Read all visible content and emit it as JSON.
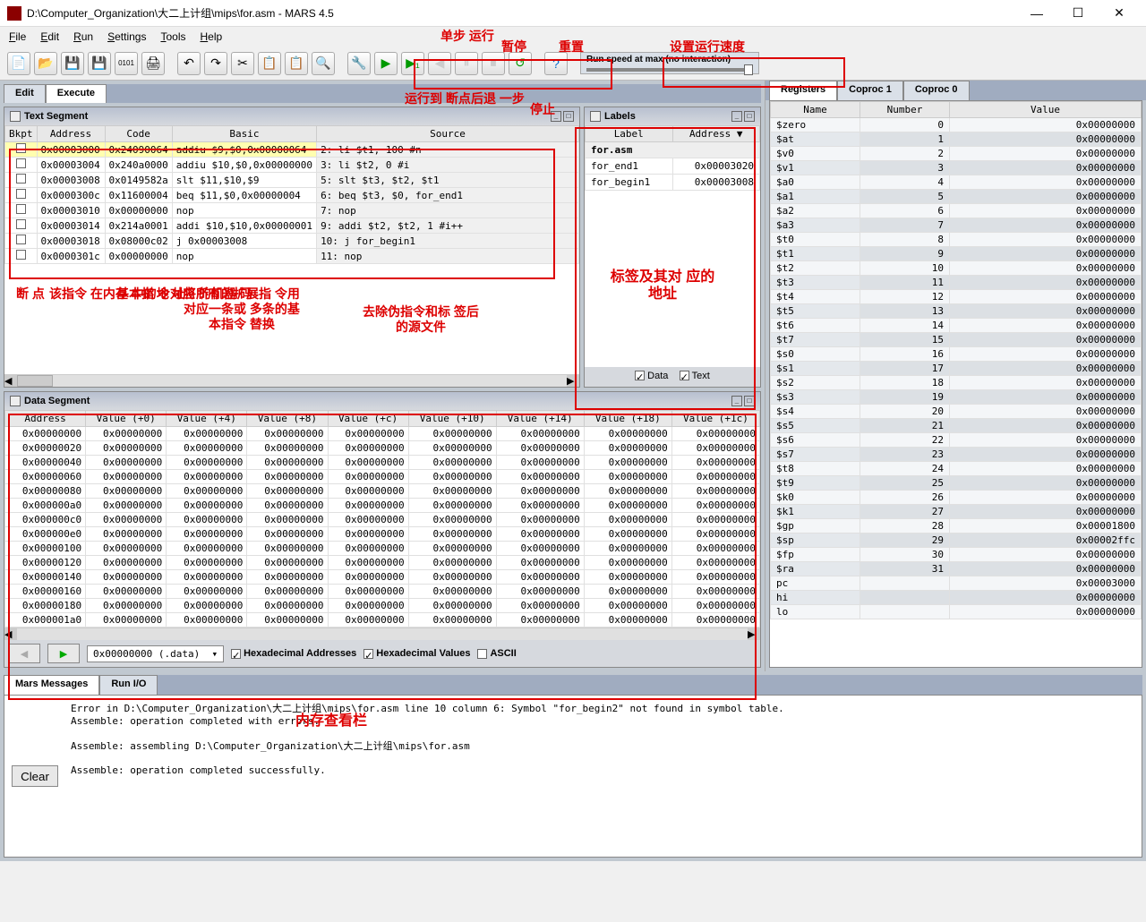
{
  "window": {
    "title": "D:\\Computer_Organization\\大二上计组\\mips\\for.asm  -  MARS 4.5"
  },
  "menu": {
    "items": [
      "File",
      "Edit",
      "Run",
      "Settings",
      "Tools",
      "Help"
    ]
  },
  "annotations": {
    "step": "单步\n运行",
    "pause": "暂停",
    "reset": "重置",
    "speed": "设置运行速度",
    "runToBp": "运行到\n断点",
    "stepBack": "后退\n一步",
    "stop": "停止",
    "bkpt": "断\n点",
    "addrNote": "该指令\n在内存\n中的地\n址",
    "codeNote": "基本指\n令对应\n的机器\n码",
    "basicNote": "将所有的扩展指\n令用对应一条或\n多条的基本指令\n替换",
    "sourceNote": "去除伪指令和标\n签后的源文件",
    "labelsNote": "标签及其对\n应的地址",
    "dataNote": "内存查看栏"
  },
  "speed": {
    "label": "Run speed at max (no interaction)"
  },
  "tabs": {
    "edit": "Edit",
    "execute": "Execute"
  },
  "regTabs": {
    "r": "Registers",
    "c1": "Coproc 1",
    "c0": "Coproc 0"
  },
  "textSeg": {
    "title": "Text Segment",
    "headers": {
      "bkpt": "Bkpt",
      "addr": "Address",
      "code": "Code",
      "basic": "Basic",
      "source": "Source"
    },
    "rows": [
      {
        "addr": "0x00003000",
        "code": "0x24090064",
        "basic": "addiu $9,$0,0x00000064",
        "src": "2: li $t1, 100 #n",
        "hl": true
      },
      {
        "addr": "0x00003004",
        "code": "0x240a0000",
        "basic": "addiu $10,$0,0x00000000",
        "src": "3: li $t2, 0   #i"
      },
      {
        "addr": "0x00003008",
        "code": "0x0149582a",
        "basic": "slt $11,$10,$9",
        "src": "5:    slt $t3, $t2, $t1"
      },
      {
        "addr": "0x0000300c",
        "code": "0x11600004",
        "basic": "beq $11,$0,0x00000004",
        "src": "6:    beq $t3, $0, for_end1"
      },
      {
        "addr": "0x00003010",
        "code": "0x00000000",
        "basic": "nop",
        "src": "7:    nop"
      },
      {
        "addr": "0x00003014",
        "code": "0x214a0001",
        "basic": "addi $10,$10,0x00000001",
        "src": "9:    addi $t2, $t2, 1 #i++"
      },
      {
        "addr": "0x00003018",
        "code": "0x08000c02",
        "basic": "j 0x00003008",
        "src": "10:   j for_begin1"
      },
      {
        "addr": "0x0000301c",
        "code": "0x00000000",
        "basic": "nop",
        "src": "11:   nop"
      }
    ]
  },
  "labels": {
    "title": "Labels",
    "headers": {
      "label": "Label",
      "addr": "Address ▼"
    },
    "file": "for.asm",
    "rows": [
      {
        "label": "for_end1",
        "addr": "0x00003020"
      },
      {
        "label": "for_begin1",
        "addr": "0x00003008"
      }
    ],
    "checks": {
      "data": "Data",
      "text": "Text"
    }
  },
  "dataSeg": {
    "title": "Data Segment",
    "headers": [
      "Address",
      "Value (+0)",
      "Value (+4)",
      "Value (+8)",
      "Value (+c)",
      "Value (+10)",
      "Value (+14)",
      "Value (+18)",
      "Value (+1c)"
    ],
    "addrs": [
      "0x00000000",
      "0x00000020",
      "0x00000040",
      "0x00000060",
      "0x00000080",
      "0x000000a0",
      "0x000000c0",
      "0x000000e0",
      "0x00000100",
      "0x00000120",
      "0x00000140",
      "0x00000160",
      "0x00000180",
      "0x000001a0"
    ],
    "zero": "0x00000000",
    "combo": "0x00000000 (.data)",
    "hexAddr": "Hexadecimal Addresses",
    "hexVal": "Hexadecimal Values",
    "ascii": "ASCII"
  },
  "registers": {
    "headers": {
      "name": "Name",
      "num": "Number",
      "val": "Value"
    },
    "rows": [
      {
        "n": "$zero",
        "i": "0",
        "v": "0x00000000"
      },
      {
        "n": "$at",
        "i": "1",
        "v": "0x00000000"
      },
      {
        "n": "$v0",
        "i": "2",
        "v": "0x00000000"
      },
      {
        "n": "$v1",
        "i": "3",
        "v": "0x00000000"
      },
      {
        "n": "$a0",
        "i": "4",
        "v": "0x00000000"
      },
      {
        "n": "$a1",
        "i": "5",
        "v": "0x00000000"
      },
      {
        "n": "$a2",
        "i": "6",
        "v": "0x00000000"
      },
      {
        "n": "$a3",
        "i": "7",
        "v": "0x00000000"
      },
      {
        "n": "$t0",
        "i": "8",
        "v": "0x00000000"
      },
      {
        "n": "$t1",
        "i": "9",
        "v": "0x00000000"
      },
      {
        "n": "$t2",
        "i": "10",
        "v": "0x00000000"
      },
      {
        "n": "$t3",
        "i": "11",
        "v": "0x00000000"
      },
      {
        "n": "$t4",
        "i": "12",
        "v": "0x00000000"
      },
      {
        "n": "$t5",
        "i": "13",
        "v": "0x00000000"
      },
      {
        "n": "$t6",
        "i": "14",
        "v": "0x00000000"
      },
      {
        "n": "$t7",
        "i": "15",
        "v": "0x00000000"
      },
      {
        "n": "$s0",
        "i": "16",
        "v": "0x00000000"
      },
      {
        "n": "$s1",
        "i": "17",
        "v": "0x00000000"
      },
      {
        "n": "$s2",
        "i": "18",
        "v": "0x00000000"
      },
      {
        "n": "$s3",
        "i": "19",
        "v": "0x00000000"
      },
      {
        "n": "$s4",
        "i": "20",
        "v": "0x00000000"
      },
      {
        "n": "$s5",
        "i": "21",
        "v": "0x00000000"
      },
      {
        "n": "$s6",
        "i": "22",
        "v": "0x00000000"
      },
      {
        "n": "$s7",
        "i": "23",
        "v": "0x00000000"
      },
      {
        "n": "$t8",
        "i": "24",
        "v": "0x00000000"
      },
      {
        "n": "$t9",
        "i": "25",
        "v": "0x00000000"
      },
      {
        "n": "$k0",
        "i": "26",
        "v": "0x00000000"
      },
      {
        "n": "$k1",
        "i": "27",
        "v": "0x00000000"
      },
      {
        "n": "$gp",
        "i": "28",
        "v": "0x00001800"
      },
      {
        "n": "$sp",
        "i": "29",
        "v": "0x00002ffc"
      },
      {
        "n": "$fp",
        "i": "30",
        "v": "0x00000000"
      },
      {
        "n": "$ra",
        "i": "31",
        "v": "0x00000000"
      },
      {
        "n": "pc",
        "i": "",
        "v": "0x00003000"
      },
      {
        "n": "hi",
        "i": "",
        "v": "0x00000000"
      },
      {
        "n": "lo",
        "i": "",
        "v": "0x00000000"
      }
    ]
  },
  "messages": {
    "tab1": "Mars Messages",
    "tab2": "Run I/O",
    "clear": "Clear",
    "text": "Error in D:\\Computer_Organization\\大二上计组\\mips\\for.asm line 10 column 6: Symbol \"for_begin2\" not found in symbol table.\nAssemble: operation completed with errors.\n\nAssemble: assembling D:\\Computer_Organization\\大二上计组\\mips\\for.asm\n\nAssemble: operation completed successfully."
  }
}
